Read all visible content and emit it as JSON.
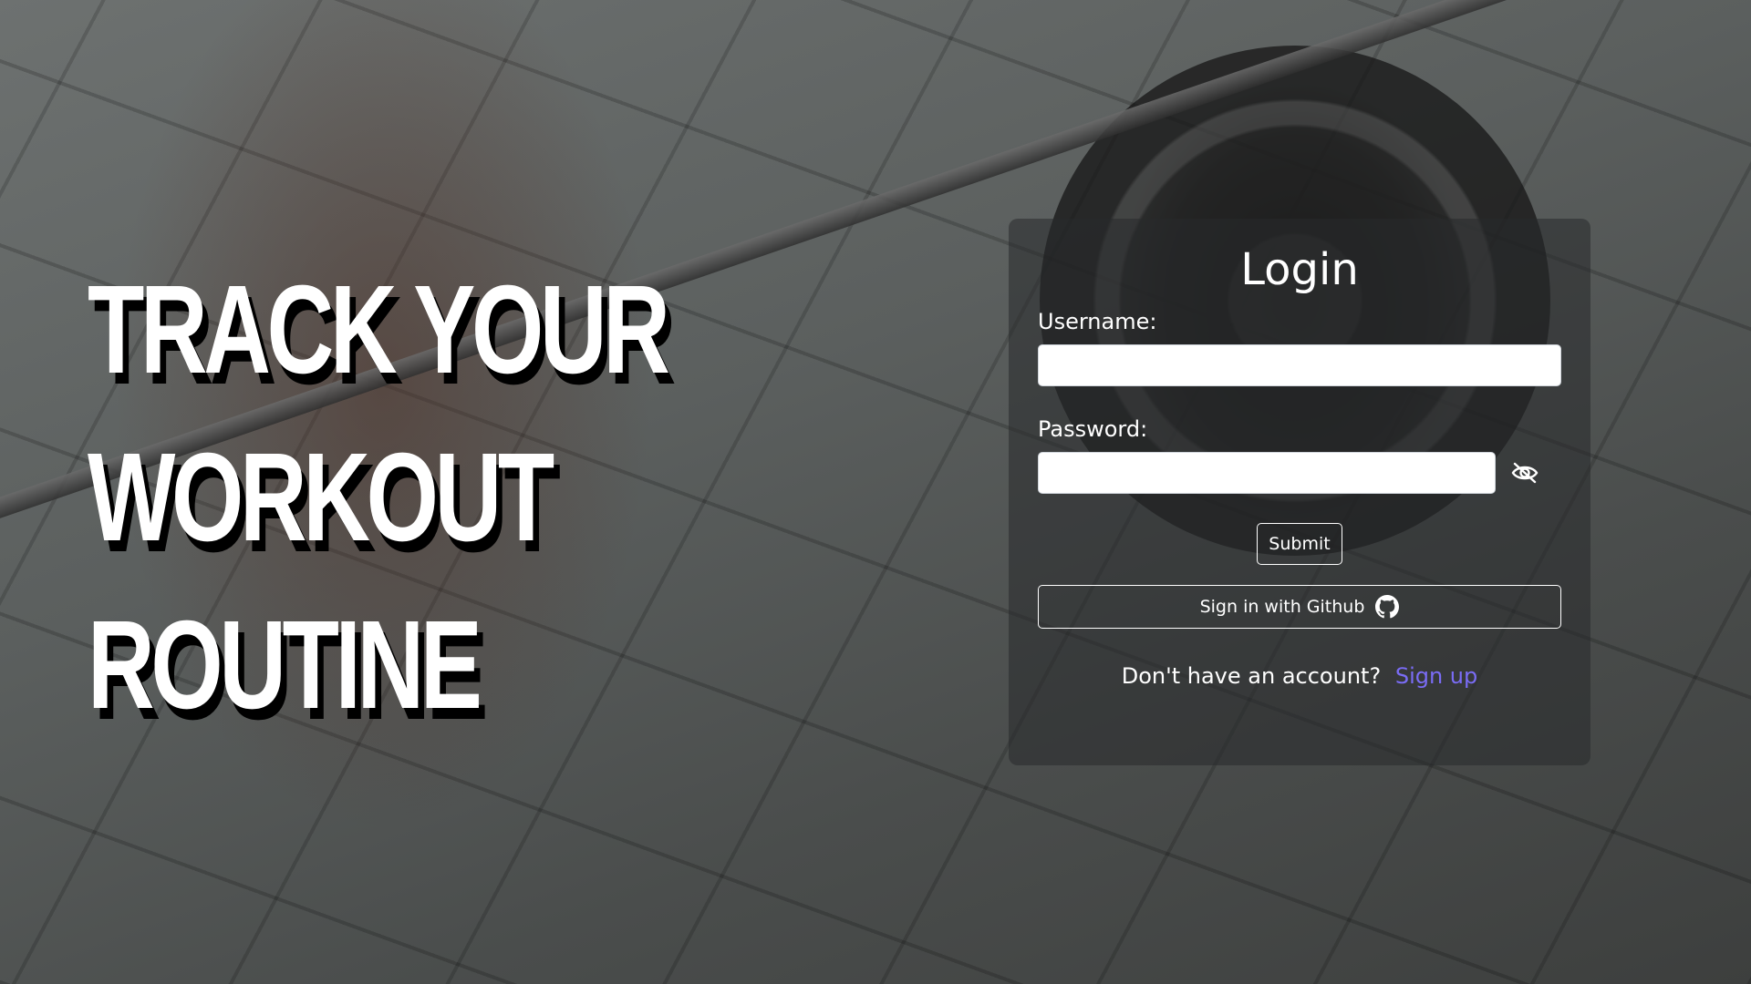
{
  "hero": {
    "line1": "TRACK YOUR",
    "line2": "WORKOUT",
    "line3": "ROUTINE"
  },
  "login": {
    "title": "Login",
    "username_label": "Username:",
    "username_value": "",
    "password_label": "Password:",
    "password_value": "",
    "password_toggle_icon": "eye-slash-icon",
    "submit_label": "Submit",
    "github_label": "Sign in with Github",
    "github_icon": "github-icon",
    "signup_prompt": "Don't have an account?",
    "signup_link": "Sign up"
  },
  "colors": {
    "link": "#7a6cf5",
    "card_bg": "rgba(40,42,44,0.55)",
    "text": "#ffffff"
  }
}
